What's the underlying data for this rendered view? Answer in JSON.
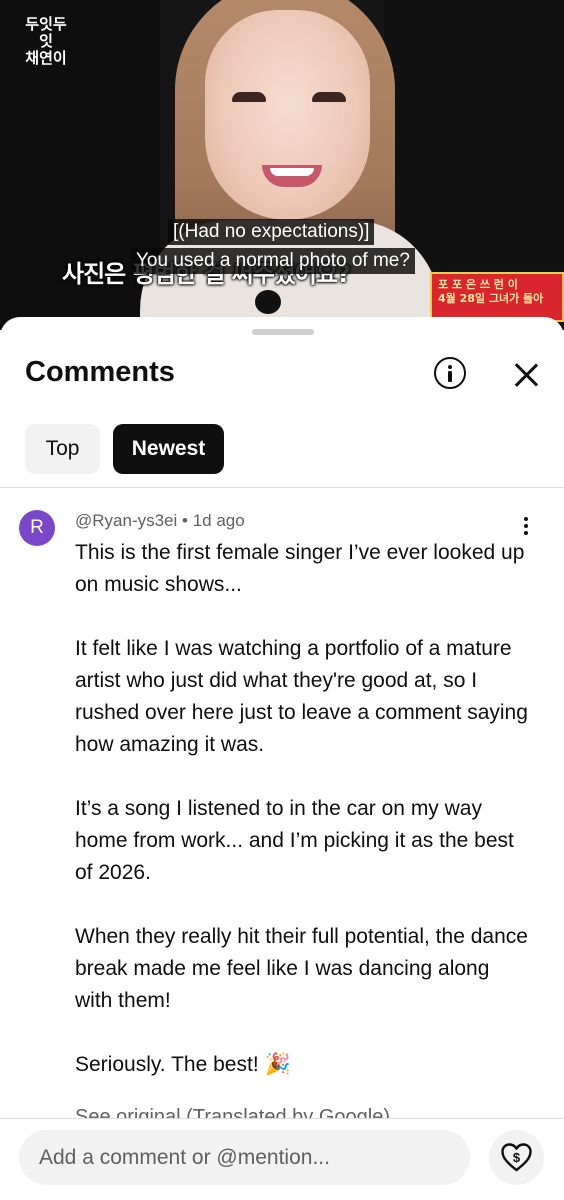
{
  "video": {
    "channel_logo": "두잇두잇\n채연이",
    "korean_subtitle": "사진은 평범한 걸 써주셨어요?",
    "caption_line1": "[(Had no expectations)]",
    "caption_line2": "You used a normal photo of me?",
    "sign_text": "포 포 은 쓰 런 이\n4월 28일 그녀가 돌아"
  },
  "comments": {
    "title": "Comments",
    "tabs": [
      {
        "label": "Top",
        "selected": false
      },
      {
        "label": "Newest",
        "selected": true
      }
    ],
    "items": [
      {
        "avatar_letter": "R",
        "avatar_color": "#7b47c9",
        "author": "@Ryan-ys3ei",
        "time": "1d ago",
        "paragraphs": [
          "This is the first female singer I’ve ever looked up on music shows...",
          "It felt like I was watching a portfolio of a mature artist who just did what they're good at, so I rushed over here just to leave a comment saying how amazing it was.",
          "It’s a song I listened to in the car on my way home from work... and I’m picking it as the best of 2026.",
          "When they really hit their full potential, the dance break made me feel like I was dancing along with them!",
          "Seriously. The best! 🎉"
        ],
        "translation_note": "See original (Translated by Google)"
      }
    ],
    "input_placeholder": "Add a comment or @mention..."
  },
  "icons": {
    "info": "info-icon",
    "close": "close-icon",
    "more": "more-vertical-icon",
    "thanks": "super-thanks-icon"
  }
}
